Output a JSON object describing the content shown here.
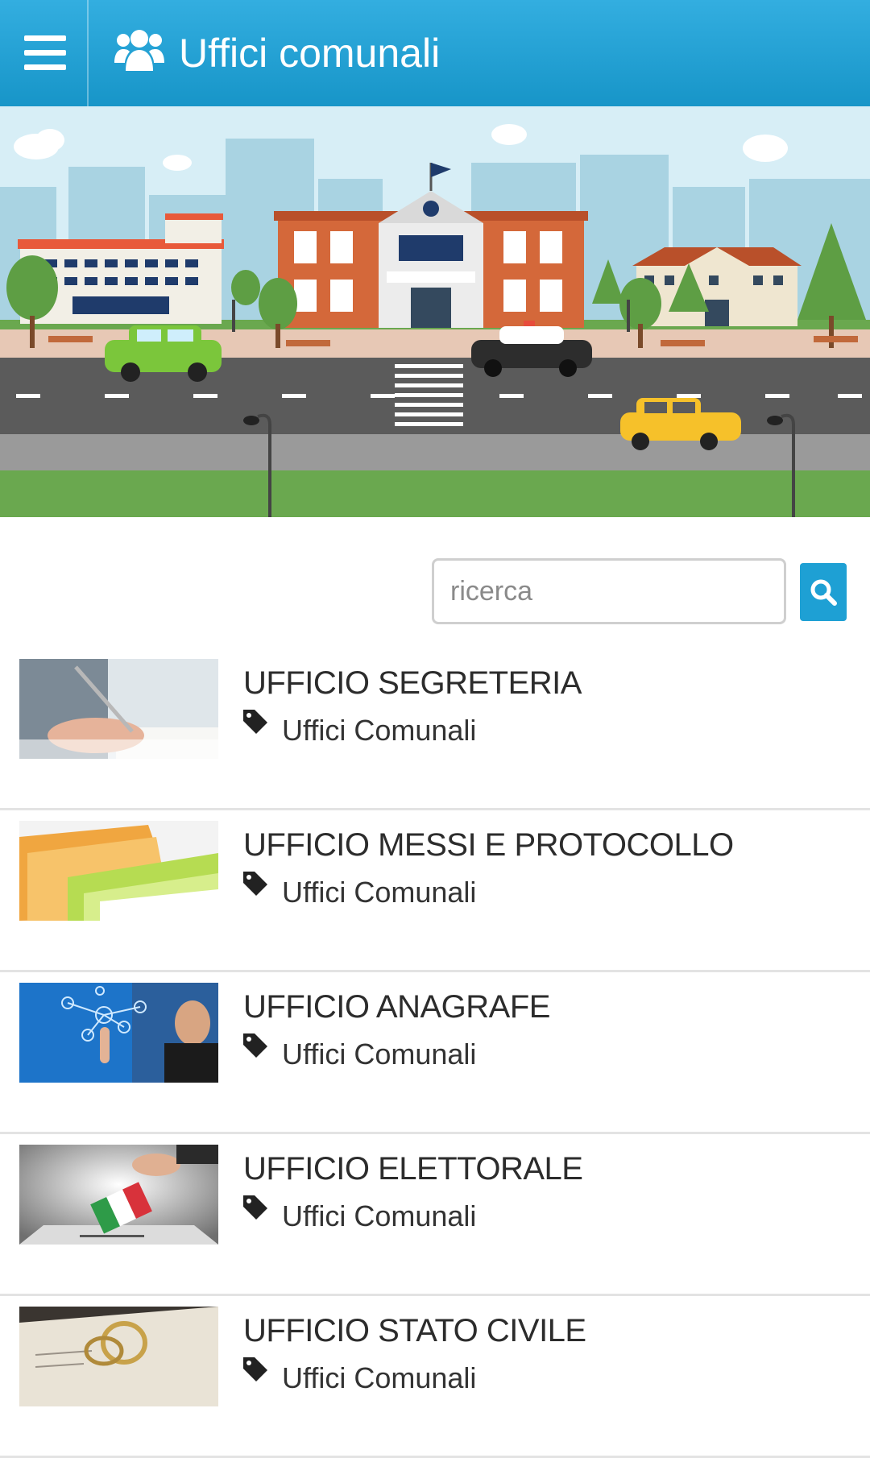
{
  "header": {
    "title": "Uffici comunali",
    "menu_icon": "hamburger-icon",
    "title_icon": "users-icon",
    "color": "#1e9fd4"
  },
  "search": {
    "placeholder": "ricerca",
    "value": "",
    "button_icon": "search-icon"
  },
  "items": [
    {
      "title": "UFFICIO SEGRETERIA",
      "tag": "Uffici Comunali",
      "thumb": "writing-hand"
    },
    {
      "title": "UFFICIO MESSI E PROTOCOLLO",
      "tag": "Uffici Comunali",
      "thumb": "folders"
    },
    {
      "title": "UFFICIO ANAGRAFE",
      "tag": "Uffici Comunali",
      "thumb": "network-people"
    },
    {
      "title": "UFFICIO ELETTORALE",
      "tag": "Uffici Comunali",
      "thumb": "ballot-box"
    },
    {
      "title": "UFFICIO STATO CIVILE",
      "tag": "Uffici Comunali",
      "thumb": "wedding-rings"
    }
  ]
}
